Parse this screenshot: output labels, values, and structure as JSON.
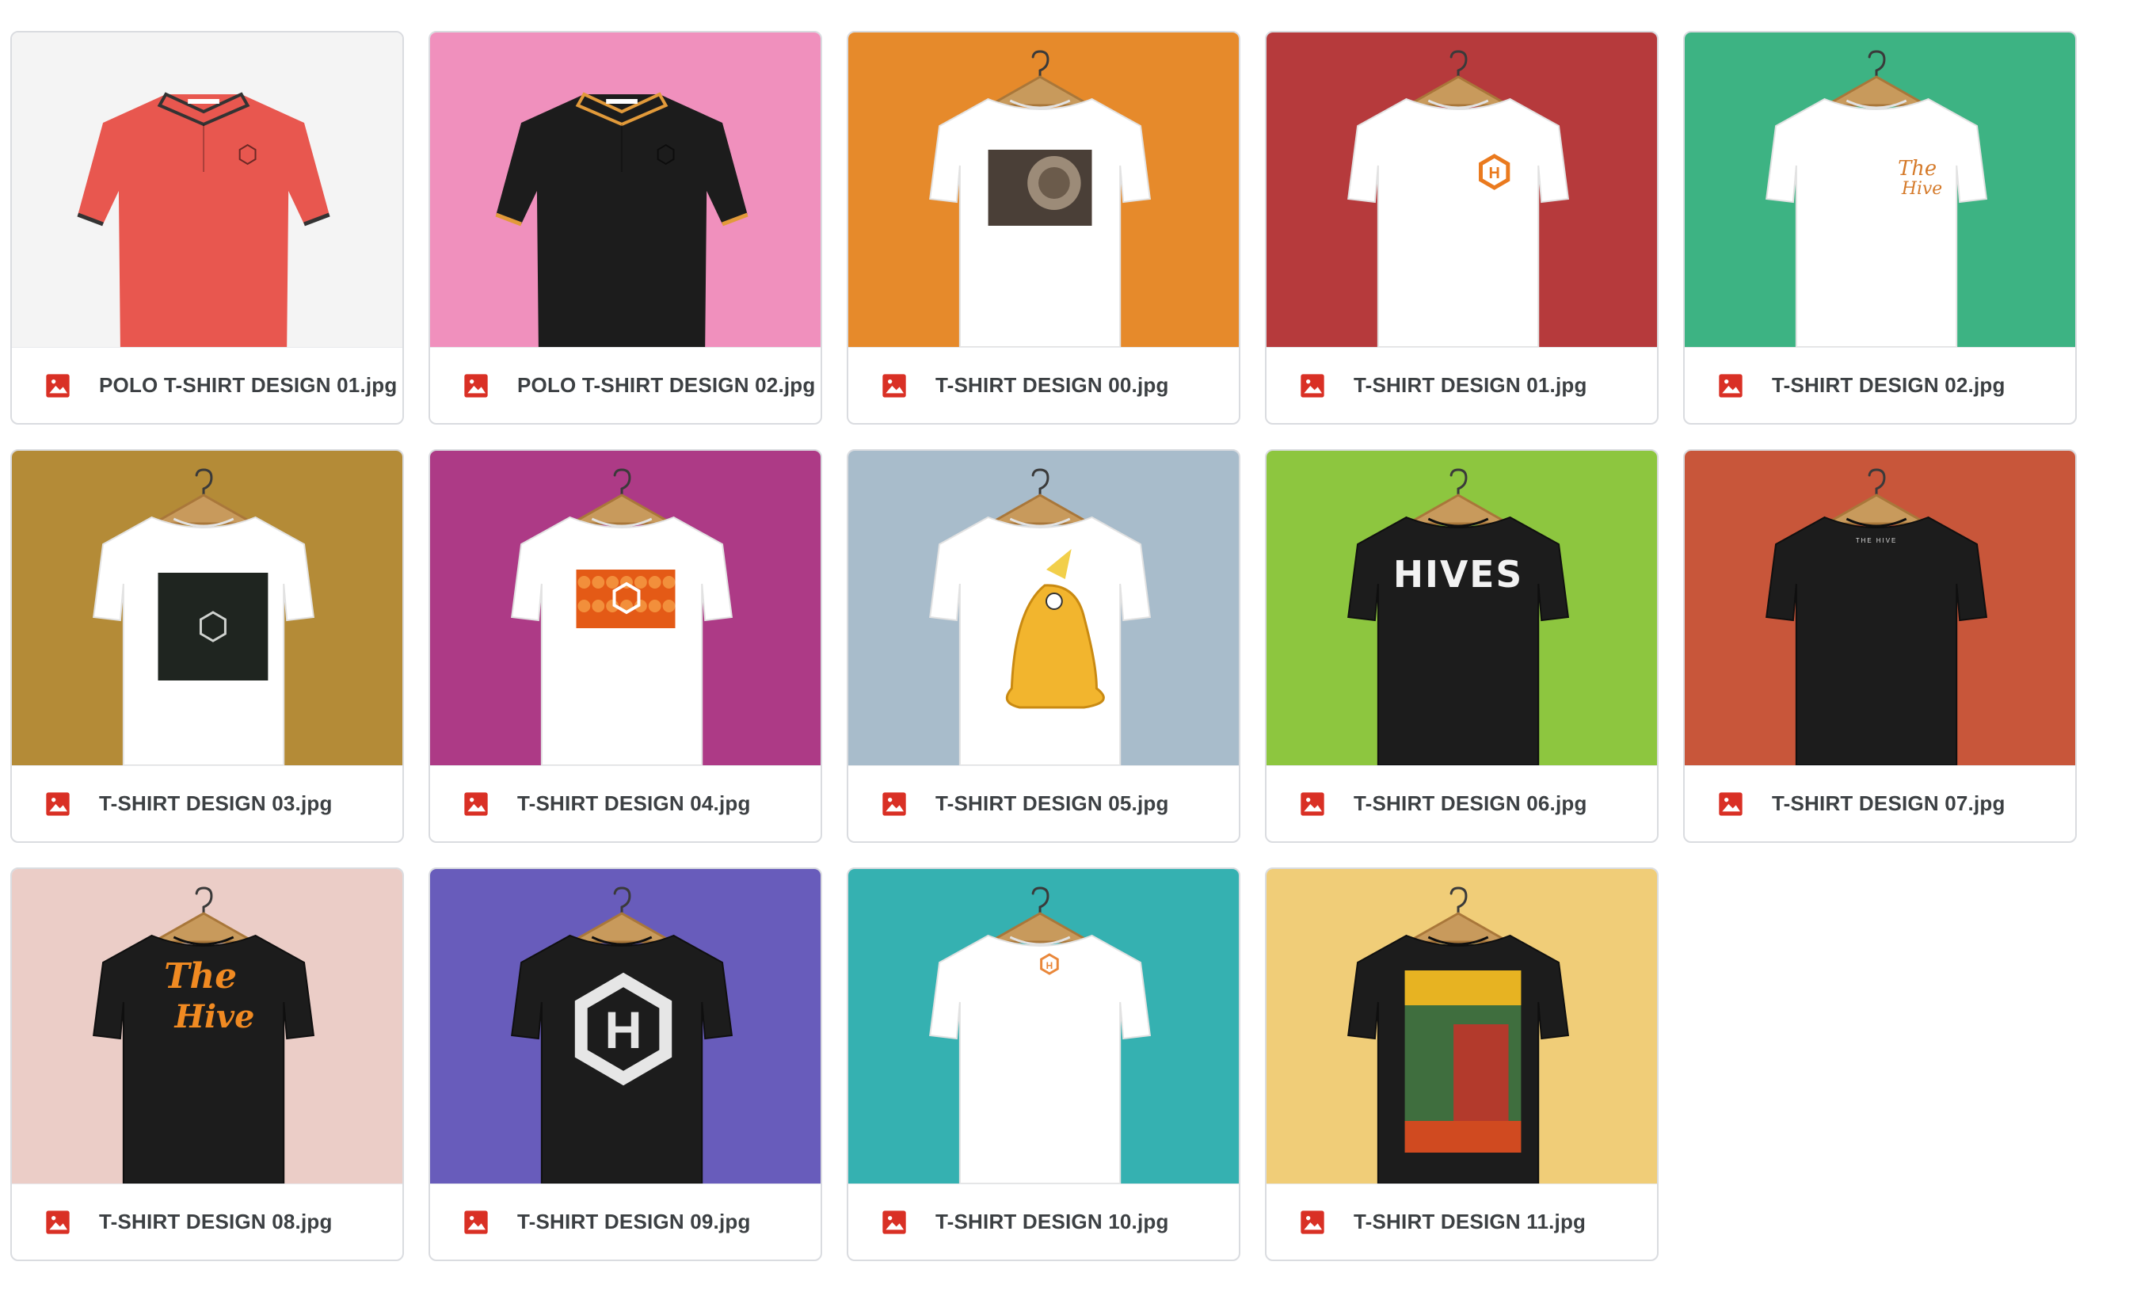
{
  "files": [
    {
      "name": "POLO T-SHIRT DESIGN 01.jpg",
      "icon": "image-file-icon",
      "bg": "#f4f4f4",
      "shirt": "#e8574f",
      "style": "polo",
      "trim": "#333333"
    },
    {
      "name": "POLO T-SHIRT DESIGN 02.jpg",
      "icon": "image-file-icon",
      "bg": "#f090bd",
      "shirt": "#1c1c1c",
      "style": "polo",
      "trim": "#e29a3a"
    },
    {
      "name": "T-SHIRT DESIGN 00.jpg",
      "icon": "image-file-icon",
      "bg": "#e68a2b",
      "shirt": "#ffffff",
      "style": "tee",
      "print": "photo-honeycomb"
    },
    {
      "name": "T-SHIRT DESIGN 01.jpg",
      "icon": "image-file-icon",
      "bg": "#b63a3c",
      "shirt": "#ffffff",
      "style": "tee",
      "print": "hex-logo"
    },
    {
      "name": "T-SHIRT DESIGN 02.jpg",
      "icon": "image-file-icon",
      "bg": "#3db383",
      "shirt": "#ffffff",
      "style": "tee",
      "print": "script-small"
    },
    {
      "name": "T-SHIRT DESIGN 03.jpg",
      "icon": "image-file-icon",
      "bg": "#b48b37",
      "shirt": "#ffffff",
      "style": "tee",
      "print": "dark-square"
    },
    {
      "name": "T-SHIRT DESIGN 04.jpg",
      "icon": "image-file-icon",
      "bg": "#ad3a86",
      "shirt": "#ffffff",
      "style": "tee",
      "print": "honeycomb-orange"
    },
    {
      "name": "T-SHIRT DESIGN 05.jpg",
      "icon": "image-file-icon",
      "bg": "#a8bccb",
      "shirt": "#ffffff",
      "style": "tee",
      "print": "honey-character"
    },
    {
      "name": "T-SHIRT DESIGN 06.jpg",
      "icon": "image-file-icon",
      "bg": "#8dc63f",
      "shirt": "#1c1c1c",
      "style": "tee",
      "print": "hives-text"
    },
    {
      "name": "T-SHIRT DESIGN 07.jpg",
      "icon": "image-file-icon",
      "bg": "#c8563a",
      "shirt": "#1c1c1c",
      "style": "tee",
      "print": "tiny-text"
    },
    {
      "name": "T-SHIRT DESIGN 08.jpg",
      "icon": "image-file-icon",
      "bg": "#ebcdc7",
      "shirt": "#1c1c1c",
      "style": "tee",
      "print": "script-large"
    },
    {
      "name": "T-SHIRT DESIGN 09.jpg",
      "icon": "image-file-icon",
      "bg": "#685cbb",
      "shirt": "#1c1c1c",
      "style": "tee",
      "print": "hex-large"
    },
    {
      "name": "T-SHIRT DESIGN 10.jpg",
      "icon": "image-file-icon",
      "bg": "#35b1b1",
      "shirt": "#ffffff",
      "style": "tee",
      "print": "hex-tiny"
    },
    {
      "name": "T-SHIRT DESIGN 11.jpg",
      "icon": "image-file-icon",
      "bg": "#f0cd78",
      "shirt": "#1c1c1c",
      "style": "tee",
      "print": "comic-cover"
    }
  ],
  "colors": {
    "image_icon_red": "#d93025",
    "card_border": "#dadce0",
    "label_text": "#3c4043"
  }
}
